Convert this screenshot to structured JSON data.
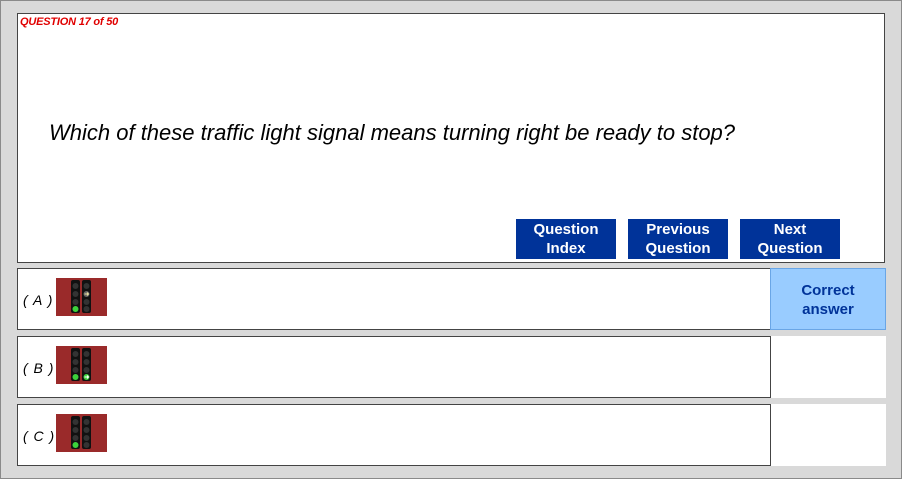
{
  "question": {
    "counter": "QUESTION 17 of 50",
    "text": "Which of these traffic light signal means turning right be ready to stop?"
  },
  "nav": {
    "index_line1": "Question",
    "index_line2": "Index",
    "prev_line1": "Previous",
    "prev_line2": "Question",
    "next_line1": "Next",
    "next_line2": "Question"
  },
  "options": [
    {
      "label": "( A )",
      "image": "traffic-signal-icon",
      "correct": true
    },
    {
      "label": "( B )",
      "image": "traffic-signal-icon",
      "correct": false
    },
    {
      "label": "( C )",
      "image": "traffic-signal-icon",
      "correct": false
    }
  ],
  "feedback": {
    "correct_line1": "Correct",
    "correct_line2": "answer"
  },
  "colors": {
    "counter_red": "#e00000",
    "button_blue": "#003399",
    "correct_bg": "#99ccff",
    "signal_bg": "#9a2a2a"
  }
}
